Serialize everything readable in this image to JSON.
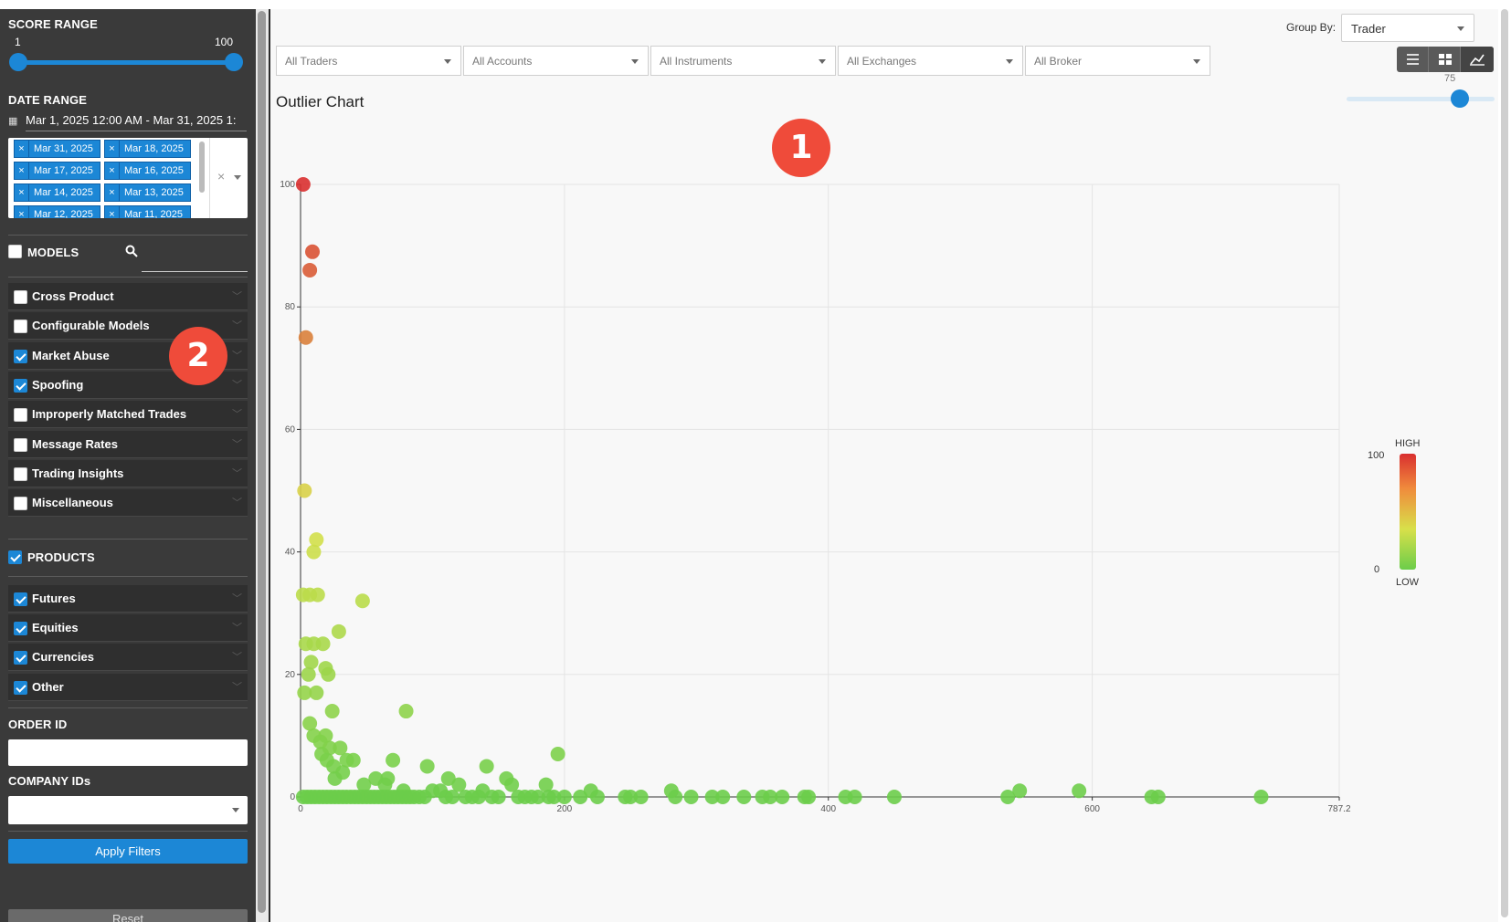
{
  "sidebar": {
    "score_range": {
      "title": "SCORE RANGE",
      "min_label": "1",
      "max_label": "100",
      "min": 1,
      "max": 100
    },
    "date_range": {
      "title": "DATE RANGE",
      "value": "Mar 1, 2025 12:00 AM - Mar 31, 2025 1:",
      "tags": [
        "Mar 31, 2025",
        "Mar 18, 2025",
        "Mar 17, 2025",
        "Mar 16, 2025",
        "Mar 14, 2025",
        "Mar 13, 2025",
        "Mar 12, 2025",
        "Mar 11, 2025"
      ],
      "clear_glyph": "×",
      "tag_remove_glyph": "×"
    },
    "models": {
      "title": "MODELS",
      "checked": false,
      "items": [
        {
          "label": "Cross Product",
          "checked": false
        },
        {
          "label": "Configurable Models",
          "checked": false
        },
        {
          "label": "Market Abuse",
          "checked": true
        },
        {
          "label": "Spoofing",
          "checked": true
        },
        {
          "label": "Improperly Matched Trades",
          "checked": false
        },
        {
          "label": "Message Rates",
          "checked": false
        },
        {
          "label": "Trading Insights",
          "checked": false
        },
        {
          "label": "Miscellaneous",
          "checked": false
        }
      ]
    },
    "products": {
      "title": "PRODUCTS",
      "checked": true,
      "items": [
        {
          "label": "Futures",
          "checked": true
        },
        {
          "label": "Equities",
          "checked": true
        },
        {
          "label": "Currencies",
          "checked": true
        },
        {
          "label": "Other",
          "checked": true
        }
      ]
    },
    "order_id": {
      "title": "ORDER ID",
      "value": ""
    },
    "company_ids": {
      "title": "COMPANY IDs",
      "value": ""
    },
    "apply_label": "Apply Filters",
    "reset_label": "Reset"
  },
  "header": {
    "group_by_label": "Group By:",
    "group_by_value": "Trader",
    "filters": [
      "All Traders",
      "All Accounts",
      "All Instruments",
      "All Exchanges",
      "All Broker"
    ],
    "view_icons": [
      "list-icon",
      "grid-icon",
      "chart-icon"
    ],
    "active_view": 2,
    "threshold_label": "75",
    "threshold_value": 75,
    "threshold_max": 100
  },
  "badges": [
    "1",
    "2"
  ],
  "chart_data": {
    "type": "scatter",
    "title": "Outlier Chart",
    "xlabel": "",
    "ylabel": "",
    "xlim": [
      0,
      787.2
    ],
    "ylim": [
      0,
      100
    ],
    "x_ticks": [
      "0",
      "200",
      "400",
      "600",
      "787.2"
    ],
    "y_ticks": [
      "0",
      "20",
      "40",
      "60",
      "80",
      "100"
    ],
    "grid": true,
    "legend": {
      "high_label": "HIGH",
      "low_label": "LOW",
      "max_label": "100",
      "min_label": "0",
      "placement": "right"
    },
    "colors": {
      "low": "#6ccd4a",
      "mid": "#d8e04a",
      "high": "#d92f2f"
    },
    "points": [
      [
        2,
        100
      ],
      [
        9,
        89
      ],
      [
        7,
        86
      ],
      [
        4,
        75
      ],
      [
        3,
        50
      ],
      [
        12,
        42
      ],
      [
        10,
        40
      ],
      [
        2,
        33
      ],
      [
        7,
        33
      ],
      [
        13,
        33
      ],
      [
        47,
        32
      ],
      [
        29,
        27
      ],
      [
        4,
        25
      ],
      [
        10,
        25
      ],
      [
        17,
        25
      ],
      [
        8,
        22
      ],
      [
        19,
        21
      ],
      [
        6,
        20
      ],
      [
        21,
        20
      ],
      [
        3,
        17
      ],
      [
        12,
        17
      ],
      [
        24,
        14
      ],
      [
        7,
        12
      ],
      [
        10,
        10
      ],
      [
        80,
        14
      ],
      [
        19,
        10
      ],
      [
        22,
        8
      ],
      [
        15,
        9
      ],
      [
        30,
        8
      ],
      [
        35,
        6
      ],
      [
        16,
        7
      ],
      [
        20,
        6
      ],
      [
        40,
        6
      ],
      [
        25,
        5
      ],
      [
        70,
        6
      ],
      [
        96,
        5
      ],
      [
        195,
        7
      ],
      [
        32,
        4
      ],
      [
        26,
        3
      ],
      [
        57,
        3
      ],
      [
        66,
        3
      ],
      [
        48,
        2
      ],
      [
        141,
        5
      ],
      [
        64,
        2
      ],
      [
        112,
        3
      ],
      [
        156,
        3
      ],
      [
        78,
        1
      ],
      [
        220,
        1
      ],
      [
        160,
        2
      ],
      [
        186,
        2
      ],
      [
        120,
        2
      ],
      [
        138,
        1
      ],
      [
        106,
        1
      ],
      [
        100,
        1
      ],
      [
        90,
        0
      ],
      [
        94,
        0
      ],
      [
        130,
        0
      ],
      [
        150,
        0
      ],
      [
        170,
        0
      ],
      [
        180,
        0
      ],
      [
        200,
        0
      ],
      [
        212,
        0
      ],
      [
        225,
        0
      ],
      [
        250,
        0
      ],
      [
        281,
        1
      ],
      [
        284,
        0
      ],
      [
        296,
        0
      ],
      [
        312,
        0
      ],
      [
        336,
        0
      ],
      [
        350,
        0
      ],
      [
        365,
        0
      ],
      [
        385,
        0
      ],
      [
        382,
        0
      ],
      [
        413,
        0
      ],
      [
        450,
        0
      ],
      [
        536,
        0
      ],
      [
        545,
        1
      ],
      [
        590,
        1
      ],
      [
        645,
        0
      ],
      [
        650,
        0
      ],
      [
        728,
        0
      ],
      [
        2,
        0
      ],
      [
        5,
        0
      ],
      [
        8,
        0
      ],
      [
        11,
        0
      ],
      [
        14,
        0
      ],
      [
        17,
        0
      ],
      [
        20,
        0
      ],
      [
        23,
        0
      ],
      [
        26,
        0
      ],
      [
        29,
        0
      ],
      [
        32,
        0
      ],
      [
        35,
        0
      ],
      [
        38,
        0
      ],
      [
        41,
        0
      ],
      [
        44,
        0
      ],
      [
        47,
        0
      ],
      [
        50,
        0
      ],
      [
        53,
        0
      ],
      [
        56,
        0
      ],
      [
        59,
        0
      ],
      [
        62,
        0
      ],
      [
        65,
        0
      ],
      [
        68,
        0
      ],
      [
        71,
        0
      ],
      [
        74,
        0
      ],
      [
        77,
        0
      ],
      [
        80,
        0
      ],
      [
        83,
        0
      ],
      [
        86,
        0
      ],
      [
        110,
        0
      ],
      [
        115,
        0
      ],
      [
        125,
        0
      ],
      [
        135,
        0
      ],
      [
        145,
        0
      ],
      [
        165,
        0
      ],
      [
        175,
        0
      ],
      [
        188,
        0
      ],
      [
        192,
        0
      ],
      [
        246,
        0
      ],
      [
        258,
        0
      ],
      [
        320,
        0
      ],
      [
        356,
        0
      ],
      [
        420,
        0
      ]
    ]
  }
}
